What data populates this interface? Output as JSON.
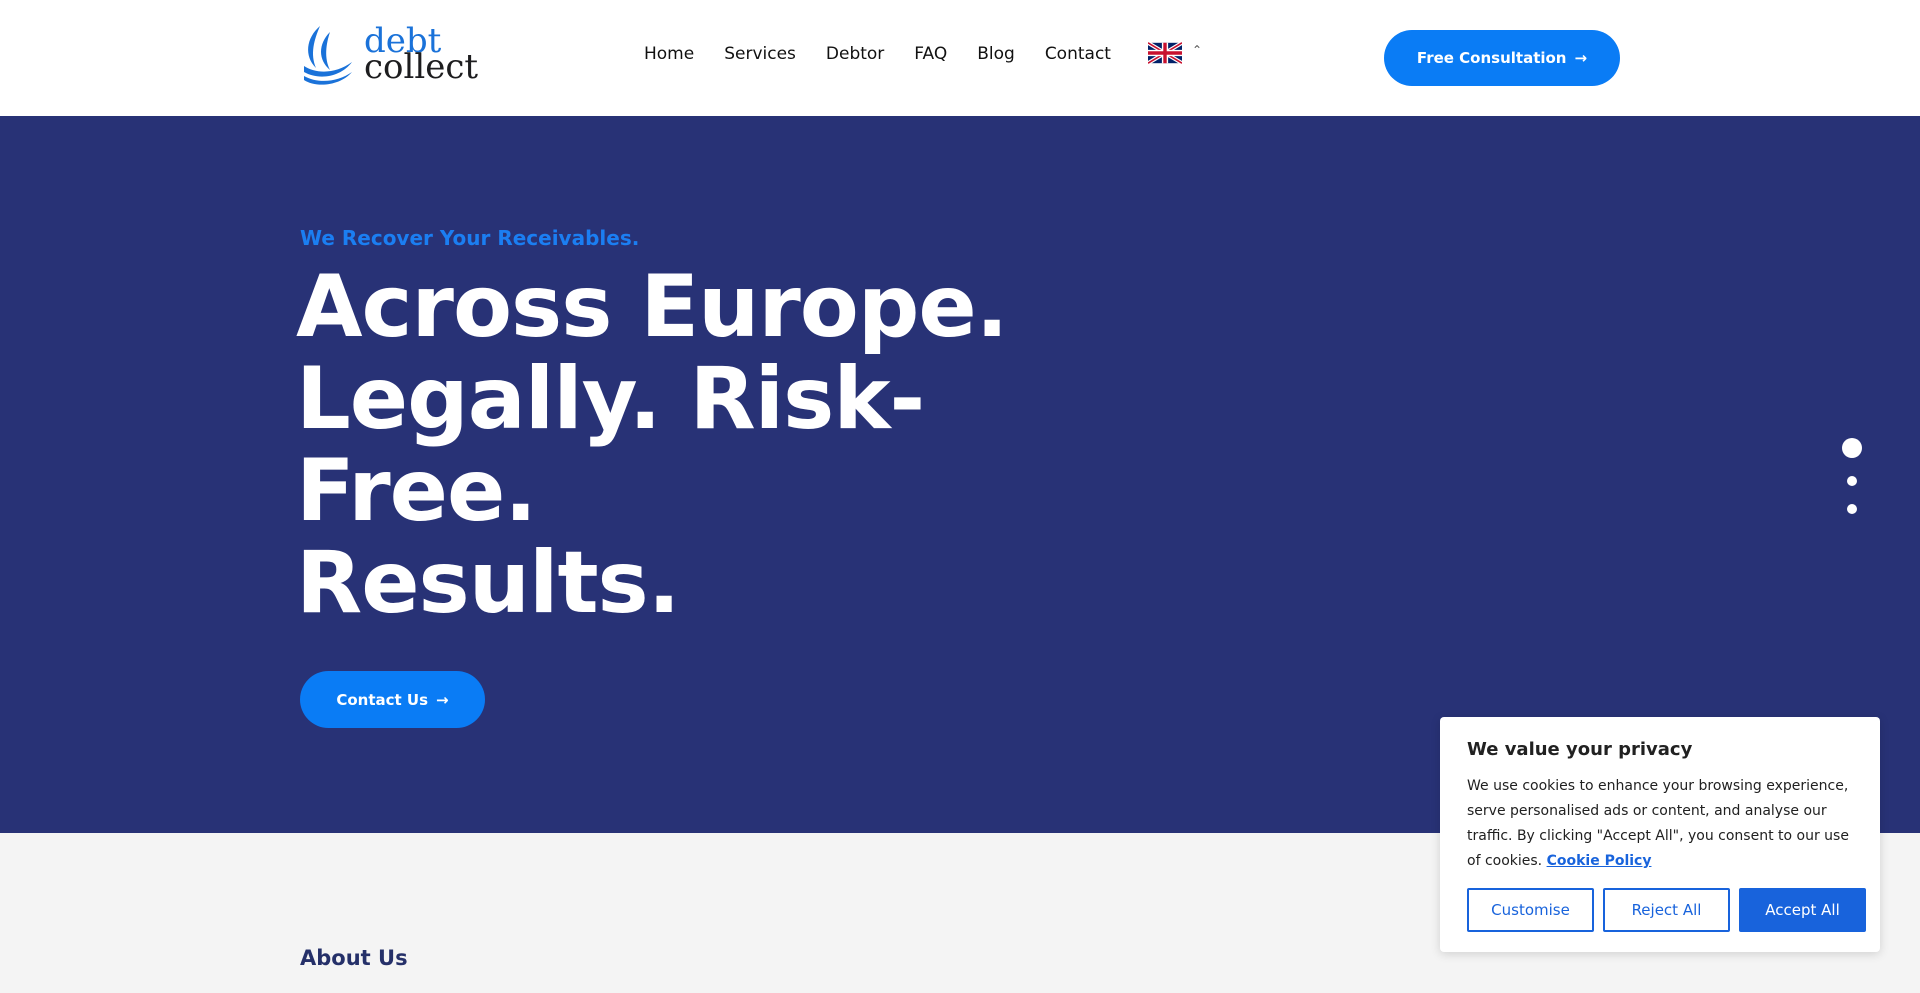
{
  "header": {
    "logo": {
      "line1": "debt",
      "line2": "collect"
    },
    "nav": [
      {
        "label": "Home"
      },
      {
        "label": "Services"
      },
      {
        "label": "Debtor"
      },
      {
        "label": "FAQ"
      },
      {
        "label": "Blog"
      },
      {
        "label": "Contact"
      }
    ],
    "language": {
      "flag_icon": "uk-flag-icon",
      "chevron_icon": "chevron-up-icon"
    },
    "cta_label": "Free Consultation",
    "cta_icon": "arrow-right-icon"
  },
  "hero": {
    "kicker": "We Recover Your Receivables.",
    "title_lines": [
      "Across Europe.",
      "Legally. Risk-",
      "Free.",
      "Results."
    ],
    "button_label": "Contact Us",
    "button_icon": "arrow-right-icon",
    "slider": {
      "count": 3,
      "active_index": 0
    }
  },
  "about": {
    "label": "About Us"
  },
  "cookie_banner": {
    "title": "We value your privacy",
    "body": "We use cookies to enhance your browsing experience, serve personalised ads or content, and analyse our traffic. By clicking \"Accept All\", you consent to our use of cookies.",
    "link_label": "Cookie Policy",
    "buttons": {
      "customise": "Customise",
      "reject": "Reject All",
      "accept": "Accept All"
    }
  },
  "colors": {
    "hero_bg": "#283276",
    "accent_blue": "#0a7cf5",
    "cookie_blue": "#1863dc",
    "kicker_blue": "#1b7ef2"
  }
}
